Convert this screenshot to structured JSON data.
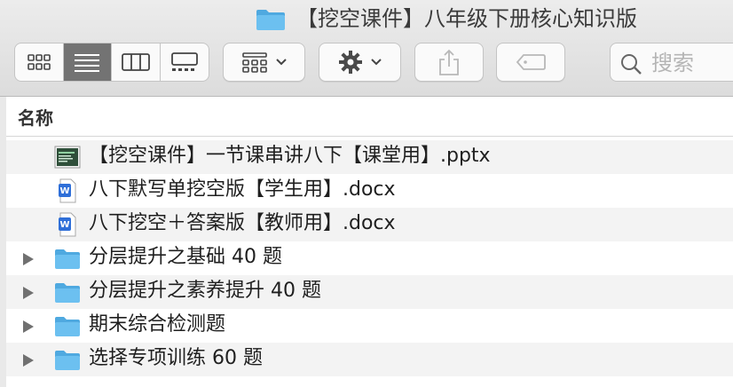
{
  "window": {
    "title": "【挖空课件】八年级下册核心知识版",
    "title_icon": "folder-icon"
  },
  "toolbar": {
    "view_modes": [
      {
        "name": "icon-view",
        "icon": "grid-icon",
        "active": false
      },
      {
        "name": "list-view",
        "icon": "list-icon",
        "active": true
      },
      {
        "name": "column-view",
        "icon": "columns-icon",
        "active": false
      },
      {
        "name": "gallery-view",
        "icon": "gallery-icon",
        "active": false
      }
    ],
    "group_icon": "group-icon",
    "action_icon": "gear-icon",
    "share_icon": "share-icon",
    "tag_icon": "tag-icon",
    "search_placeholder": "搜索"
  },
  "column_header": {
    "name_label": "名称"
  },
  "files": [
    {
      "label": "【挖空课件】一节课串讲八下【课堂用】.pptx",
      "kind": "pptx",
      "expandable": false
    },
    {
      "label": "八下默写单挖空版【学生用】.docx",
      "kind": "docx",
      "expandable": false
    },
    {
      "label": "八下挖空＋答案版【教师用】.docx",
      "kind": "docx",
      "expandable": false
    },
    {
      "label": "分层提升之基础 40 题",
      "kind": "folder",
      "expandable": true
    },
    {
      "label": "分层提升之素养提升 40 题",
      "kind": "folder",
      "expandable": true
    },
    {
      "label": "期末综合检测题",
      "kind": "folder",
      "expandable": true
    },
    {
      "label": "选择专项训练 60 题",
      "kind": "folder",
      "expandable": true
    }
  ],
  "colors": {
    "folder": "#5ab6ec",
    "folder_light": "#8fd0f5",
    "docx": "#2f6fd8",
    "active_segment": "#737373",
    "row_alt": "#f3f3f3"
  }
}
